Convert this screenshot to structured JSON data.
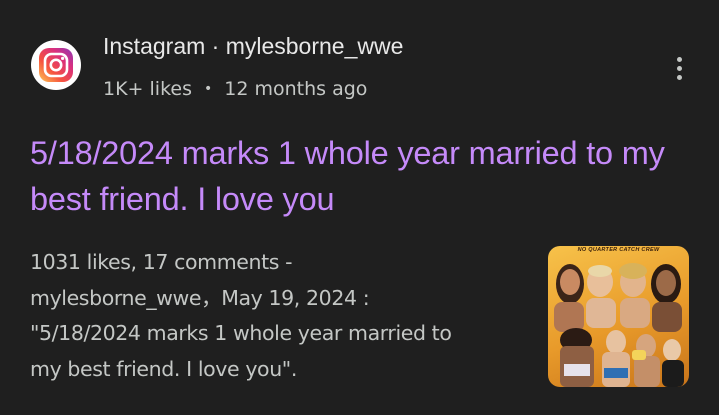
{
  "result": {
    "source_icon": "instagram-logo-icon",
    "source_label": "Instagram · mylesborne_wwe",
    "likes_label": "1K+ likes",
    "meta_separator": "•",
    "age": "12 months ago",
    "more_icon": "more-vert-icon",
    "title": "5/18/2024 marks 1 whole year married to my best friend. I love you",
    "snippet_lines": [
      "1031 likes, 17 comments -",
      "mylesborne_wwe，May 19, 2024 :",
      "\"5/18/2024 marks 1 whole year married to",
      "my best friend. I love you\"."
    ],
    "thumbnail": {
      "caption": "NO QUARTER CATCH CREW"
    }
  },
  "colors": {
    "background": "#1f1f1f",
    "title_link": "#c58af9",
    "secondary_text": "#c4c7c5",
    "thumbnail_accent": "#f0b03a"
  }
}
